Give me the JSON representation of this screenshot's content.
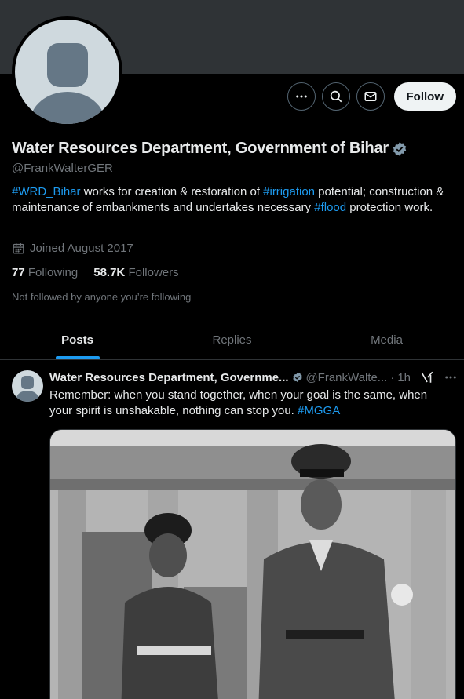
{
  "profile": {
    "display_name": "Water Resources Department, Government of Bihar",
    "handle": "@FrankWalterGER",
    "bio": {
      "tag1": "#WRD_Bihar",
      "text1": " works for creation & restoration of ",
      "tag2": "#irrigation",
      "text2": " potential; construction & maintenance of embankments and undertakes necessary ",
      "tag3": "#flood",
      "text3": " protection work."
    },
    "joined": "Joined August 2017",
    "following_count": "77",
    "following_label": "Following",
    "followers_count": "58.7K",
    "followers_label": "Followers",
    "not_followed_text": "Not followed by anyone you’re following"
  },
  "actions": {
    "follow_label": "Follow"
  },
  "tabs": [
    {
      "label": "Posts",
      "active": true
    },
    {
      "label": "Replies",
      "active": false
    },
    {
      "label": "Media",
      "active": false
    }
  ],
  "post": {
    "author_name": "Water Resources Department, Governme...",
    "author_handle": "@FrankWalte...",
    "separator": "·",
    "time": "1h",
    "text": "Remember: when you stand together, when your goal is the same, when your spirit is unshakable, nothing can stop you. ",
    "hashtag": "#MGGA"
  },
  "colors": {
    "accent": "#1d9bf0",
    "background": "#000000",
    "banner": "#2f3336",
    "muted_text": "#71767b"
  },
  "icons": [
    "more-icon",
    "search-icon",
    "message-icon",
    "verified-badge-icon",
    "calendar-icon",
    "grok-icon"
  ]
}
